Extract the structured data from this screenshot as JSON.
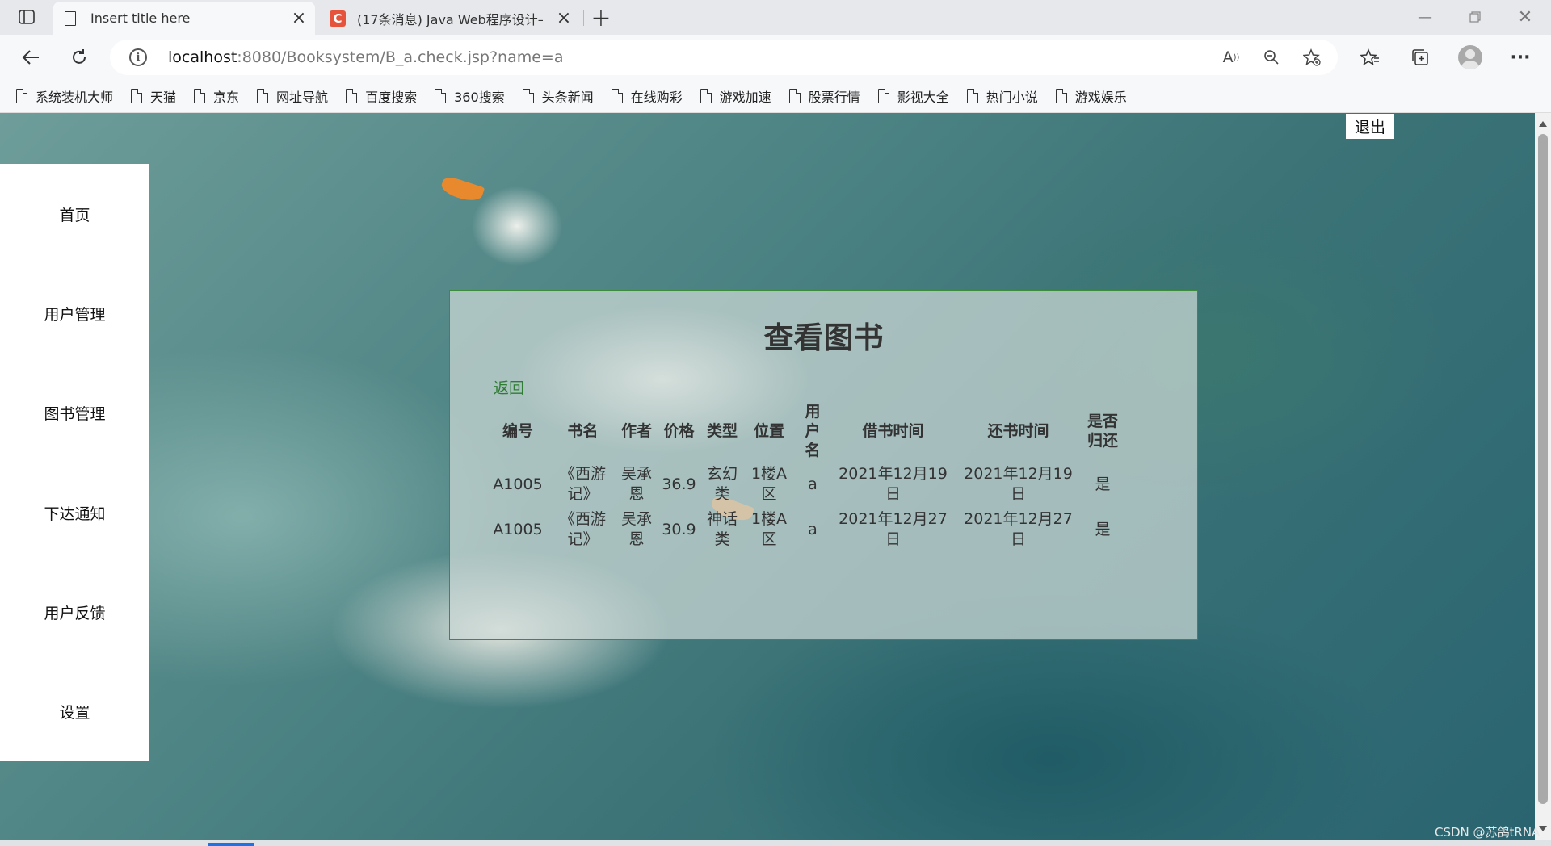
{
  "browser": {
    "tabs": [
      {
        "title": "Insert title here",
        "active": true,
        "icon": "page-icon"
      },
      {
        "title": "(17条消息) Java Web程序设计—",
        "active": false,
        "icon": "csdn-icon"
      }
    ],
    "address": {
      "host": "localhost",
      "path": ":8080/Booksystem/B_a.check.jsp?name=a"
    },
    "bookmarks": [
      "系统装机大师",
      "天猫",
      "京东",
      "网址导航",
      "百度搜索",
      "360搜索",
      "头条新闻",
      "在线购彩",
      "游戏加速",
      "股票行情",
      "影视大全",
      "热门小说",
      "游戏娱乐"
    ]
  },
  "page": {
    "logout_label": "退出",
    "sidebar": [
      "首页",
      "用户管理",
      "图书管理",
      "下达通知",
      "用户反馈",
      "设置"
    ],
    "panel_title": "查看图书",
    "back_label": "返回",
    "table": {
      "headers": [
        "编号",
        "书名",
        "作者",
        "价格",
        "类型",
        "位置",
        "用户名",
        "借书时间",
        "还书时间",
        "是否归还"
      ],
      "rows": [
        [
          "A1005",
          "《西游记》",
          "吴承恩",
          "36.9",
          "玄幻类",
          "1楼A区",
          "a",
          "2021年12月19日",
          "2021年12月19日",
          "是"
        ],
        [
          "A1005",
          "《西游记》",
          "吴承恩",
          "30.9",
          "神话类",
          "1楼A区",
          "a",
          "2021年12月27日",
          "2021年12月27日",
          "是"
        ]
      ]
    }
  },
  "watermark": "CSDN @苏鸽tRNA",
  "colors": {
    "accent_green": "#2e7d32",
    "panel_border": "#3c8c3c",
    "csdn_red": "#e5533d"
  }
}
